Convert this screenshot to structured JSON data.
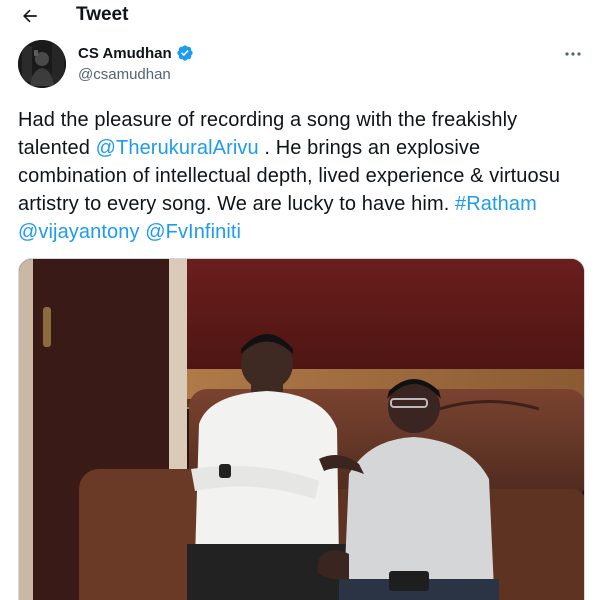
{
  "header": {
    "title": "Tweet",
    "back_icon": "arrow-left-icon"
  },
  "author": {
    "display_name": "CS Amudhan",
    "handle": "@csamudhan",
    "verified": true,
    "verified_color": "#1d9bf0",
    "more_icon": "more-horizontal-icon"
  },
  "tweet": {
    "segments": [
      {
        "text": "Had the pleasure of recording a song with the freakishly talented ",
        "type": "text"
      },
      {
        "text": "@TherukuralArivu",
        "type": "mention"
      },
      {
        "text": " . He brings an explosive combination of intellectual depth, lived experience & virtuosu artistry to every song. We are lucky to have him. ",
        "type": "text"
      },
      {
        "text": "#Ratham",
        "type": "hashtag"
      },
      {
        "text": " ",
        "type": "text"
      },
      {
        "text": "@vijayantony",
        "type": "mention"
      },
      {
        "text": " ",
        "type": "text"
      },
      {
        "text": "@FvInfiniti",
        "type": "mention"
      }
    ],
    "link_color": "#1d9bf0"
  },
  "media": {
    "kind": "photo",
    "subject": "two men seated on a brown leather sofa in a recording studio"
  }
}
